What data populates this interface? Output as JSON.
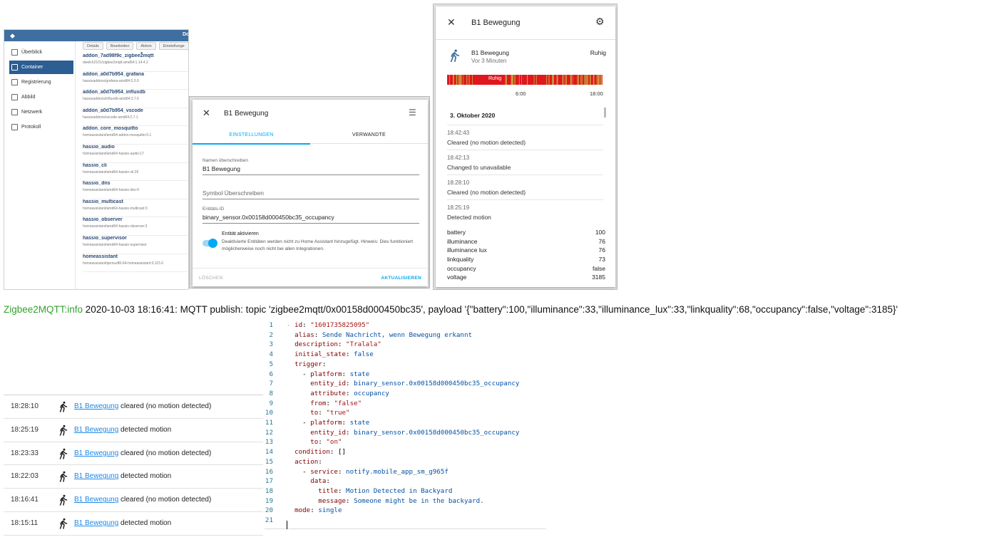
{
  "portainer": {
    "header_title": "Do",
    "nav": [
      {
        "label": "Überblick",
        "icon": "dashboard-icon"
      },
      {
        "label": "Container",
        "icon": "container-icon",
        "active": true
      },
      {
        "label": "Registrierung",
        "icon": "registry-icon"
      },
      {
        "label": "Abbild",
        "icon": "image-icon"
      },
      {
        "label": "Netzwerk",
        "icon": "network-icon"
      },
      {
        "label": "Protokoll",
        "icon": "log-icon"
      }
    ],
    "toolbar": [
      "Details",
      "Bearbeiten",
      "Aktion ▾",
      "Einstellunge"
    ],
    "containers": [
      {
        "name": "addon_7ad98f9c_zigbee2mqtt",
        "image": "dwelch2101/zigbee2mqtt-amd64:1.14.4.2"
      },
      {
        "name": "addon_a0d7b954_grafana",
        "image": "hassioaddons/grafana-amd64:3.3.0"
      },
      {
        "name": "addon_a0d7b954_influxdb",
        "image": "hassioaddons/influxdb-amd64:3.7.6"
      },
      {
        "name": "addon_a0d7b954_vscode",
        "image": "hassioaddons/vscode-amd64:2.7.1"
      },
      {
        "name": "addon_core_mosquitto",
        "image": "homeassistant/amd64-addon-mosquitto:5.1"
      },
      {
        "name": "hassio_audio",
        "image": "homeassistant/amd64-hassio-audio:17"
      },
      {
        "name": "hassio_cli",
        "image": "homeassistant/amd64-hassio-cli:26"
      },
      {
        "name": "hassio_dns",
        "image": "homeassistant/amd64-hassio-dns:9"
      },
      {
        "name": "hassio_multicast",
        "image": "homeassistant/amd64-hassio-multicast:3"
      },
      {
        "name": "hassio_observer",
        "image": "homeassistant/amd64-hassio-observer:3"
      },
      {
        "name": "hassio_supervisor",
        "image": "homeassistant/amd64-hassio-supervisor"
      },
      {
        "name": "homeassistant",
        "image": "homeassistant/qemux86-64-homeassistant:0.115.6"
      }
    ]
  },
  "settings_dialog": {
    "title": "B1 Bewegung",
    "tabs": [
      "EINSTELLUNGEN",
      "VERWANDTE"
    ],
    "name_override_label": "Namen überschreiben",
    "name_override_value": "B1 Bewegung",
    "icon_override_placeholder": "Symbol Überschreiben",
    "entity_id_label": "Entitäts-ID",
    "entity_id_value": "binary_sensor.0x00158d000450bc35_occupancy",
    "enable_label": "Entität aktivieren",
    "enable_hint": "Deaktivierte Entitäten werden nicht zu Home Assistant hinzugefügt. Hinweis: Dies funktioniert möglicherweise noch nicht bei allen Integrationen.",
    "enabled": true,
    "delete_label": "LÖSCHEN",
    "update_label": "AKTUALISIEREN",
    "accent": "#03a9f4"
  },
  "detail_dialog": {
    "title": "B1 Bewegung",
    "entity_name": "B1 Bewegung",
    "last_changed": "Vor 3 Minuten",
    "state": "Ruhig",
    "timeline_label": "Ruhig",
    "timeline_ticks": [
      "6:00",
      "18:00"
    ],
    "date_header": "3. Oktober 2020",
    "events": [
      {
        "time": "18:42:43",
        "message": "Cleared (no motion detected)"
      },
      {
        "time": "18:42:13",
        "message": "Changed to unavailable"
      },
      {
        "time": "18:28:10",
        "message": "Cleared (no motion detected)"
      },
      {
        "time": "18:25:19",
        "message": "Detected motion"
      }
    ],
    "attributes": [
      {
        "key": "battery",
        "value": "100"
      },
      {
        "key": "illuminance",
        "value": "76"
      },
      {
        "key": "illuminance lux",
        "value": "76"
      },
      {
        "key": "linkquality",
        "value": "73"
      },
      {
        "key": "occupancy",
        "value": "false"
      },
      {
        "key": "voltage",
        "value": "3185"
      }
    ],
    "colors": {
      "off": "#e0171f",
      "on": "#c8a23a"
    }
  },
  "mqtt_log": {
    "source": "Zigbee2MQTT:info",
    "message": " 2020-10-03 18:16:41: MQTT publish: topic 'zigbee2mqtt/0x00158d000450bc35', payload '{\"battery\":100,\"illuminance\":33,\"illuminance_lux\":33,\"linkquality\":68,\"occupancy\":false,\"voltage\":3185}'"
  },
  "logbook": [
    {
      "time": "18:28:10",
      "entity": "B1 Bewegung",
      "message": "cleared (no motion detected)"
    },
    {
      "time": "18:25:19",
      "entity": "B1 Bewegung",
      "message": "detected motion"
    },
    {
      "time": "18:23:33",
      "entity": "B1 Bewegung",
      "message": "cleared (no motion detected)"
    },
    {
      "time": "18:22:03",
      "entity": "B1 Bewegung",
      "message": "detected motion"
    },
    {
      "time": "18:16:41",
      "entity": "B1 Bewegung",
      "message": "cleared (no motion detected)"
    },
    {
      "time": "18:15:11",
      "entity": "B1 Bewegung",
      "message": "detected motion"
    }
  ],
  "yaml_editor": {
    "lines": [
      [
        {
          "t": "- ",
          "c": "g"
        },
        {
          "t": "id",
          "c": "k"
        },
        {
          "t": ": ",
          "c": ""
        },
        {
          "t": "\"1601735825095\"",
          "c": "s"
        }
      ],
      [
        {
          "t": "  ",
          "c": "g"
        },
        {
          "t": "alias",
          "c": "k"
        },
        {
          "t": ": ",
          "c": ""
        },
        {
          "t": "Sende Nachricht, wenn Bewegung erkannt",
          "c": "p"
        }
      ],
      [
        {
          "t": "  ",
          "c": "g"
        },
        {
          "t": "description",
          "c": "k"
        },
        {
          "t": ": ",
          "c": ""
        },
        {
          "t": "\"Tralala\"",
          "c": "s"
        }
      ],
      [
        {
          "t": "  ",
          "c": "g"
        },
        {
          "t": "initial_state",
          "c": "k"
        },
        {
          "t": ": ",
          "c": ""
        },
        {
          "t": "false",
          "c": "p"
        }
      ],
      [
        {
          "t": "  ",
          "c": "g"
        },
        {
          "t": "trigger",
          "c": "k"
        },
        {
          "t": ":",
          "c": ""
        }
      ],
      [
        {
          "t": "  ",
          "c": "g"
        },
        {
          "t": "  - ",
          "c": ""
        },
        {
          "t": "platform",
          "c": "k"
        },
        {
          "t": ": ",
          "c": ""
        },
        {
          "t": "state",
          "c": "p"
        }
      ],
      [
        {
          "t": "  ",
          "c": "g"
        },
        {
          "t": "    ",
          "c": "g"
        },
        {
          "t": "entity_id",
          "c": "k"
        },
        {
          "t": ": ",
          "c": ""
        },
        {
          "t": "binary_sensor.0x00158d000450bc35_occupancy",
          "c": "p"
        }
      ],
      [
        {
          "t": "  ",
          "c": "g"
        },
        {
          "t": "    ",
          "c": "g"
        },
        {
          "t": "attribute",
          "c": "k"
        },
        {
          "t": ": ",
          "c": ""
        },
        {
          "t": "occupancy",
          "c": "p"
        }
      ],
      [
        {
          "t": "  ",
          "c": "g"
        },
        {
          "t": "    ",
          "c": "g"
        },
        {
          "t": "from",
          "c": "k"
        },
        {
          "t": ": ",
          "c": ""
        },
        {
          "t": "\"false\"",
          "c": "s"
        }
      ],
      [
        {
          "t": "  ",
          "c": "g"
        },
        {
          "t": "    ",
          "c": "g"
        },
        {
          "t": "to",
          "c": "k"
        },
        {
          "t": ": ",
          "c": ""
        },
        {
          "t": "\"true\"",
          "c": "s"
        }
      ],
      [
        {
          "t": "  ",
          "c": "g"
        },
        {
          "t": "  - ",
          "c": ""
        },
        {
          "t": "platform",
          "c": "k"
        },
        {
          "t": ": ",
          "c": ""
        },
        {
          "t": "state",
          "c": "p"
        }
      ],
      [
        {
          "t": "  ",
          "c": "g"
        },
        {
          "t": "    ",
          "c": "g"
        },
        {
          "t": "entity_id",
          "c": "k"
        },
        {
          "t": ": ",
          "c": ""
        },
        {
          "t": "binary_sensor.0x00158d000450bc35_occupancy",
          "c": "p"
        }
      ],
      [
        {
          "t": "  ",
          "c": "g"
        },
        {
          "t": "    ",
          "c": "g"
        },
        {
          "t": "to",
          "c": "k"
        },
        {
          "t": ": ",
          "c": ""
        },
        {
          "t": "\"on\"",
          "c": "s"
        }
      ],
      [
        {
          "t": "  ",
          "c": "g"
        },
        {
          "t": "condition",
          "c": "k"
        },
        {
          "t": ": []",
          "c": ""
        }
      ],
      [
        {
          "t": "  ",
          "c": "g"
        },
        {
          "t": "action",
          "c": "k"
        },
        {
          "t": ":",
          "c": ""
        }
      ],
      [
        {
          "t": "  ",
          "c": "g"
        },
        {
          "t": "  - ",
          "c": ""
        },
        {
          "t": "service",
          "c": "k"
        },
        {
          "t": ": ",
          "c": ""
        },
        {
          "t": "notify.mobile_app_sm_g965f",
          "c": "p"
        }
      ],
      [
        {
          "t": "  ",
          "c": "g"
        },
        {
          "t": "    ",
          "c": "g"
        },
        {
          "t": "data",
          "c": "k"
        },
        {
          "t": ":",
          "c": ""
        }
      ],
      [
        {
          "t": "  ",
          "c": "g"
        },
        {
          "t": "      ",
          "c": "g"
        },
        {
          "t": "title",
          "c": "k"
        },
        {
          "t": ": ",
          "c": ""
        },
        {
          "t": "Motion Detected in Backyard",
          "c": "p"
        }
      ],
      [
        {
          "t": "  ",
          "c": "g"
        },
        {
          "t": "      ",
          "c": "g"
        },
        {
          "t": "message",
          "c": "k"
        },
        {
          "t": ": ",
          "c": ""
        },
        {
          "t": "Someone might be in the backyard.",
          "c": "p"
        }
      ],
      [
        {
          "t": "  ",
          "c": "g"
        },
        {
          "t": "mode",
          "c": "k"
        },
        {
          "t": ": ",
          "c": ""
        },
        {
          "t": "single",
          "c": "p"
        }
      ],
      []
    ]
  }
}
